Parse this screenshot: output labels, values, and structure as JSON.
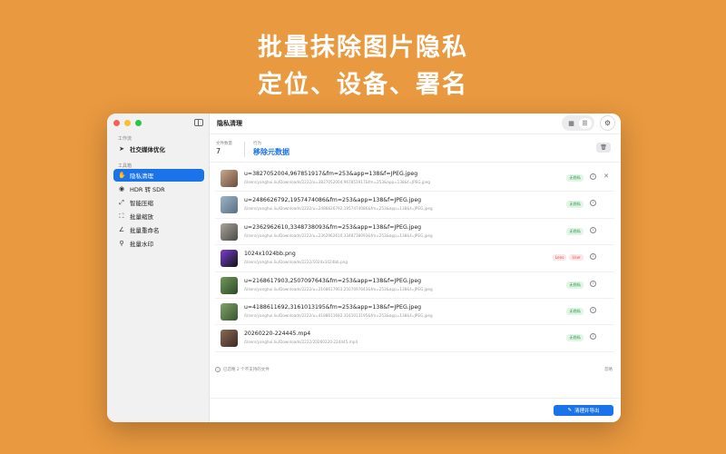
{
  "headline": {
    "line1": "批量抹除图片隐私",
    "line2": "定位、设备、署名"
  },
  "colors": {
    "background": "#E9993F",
    "accent": "#1a73e8",
    "badge_green": "#2f9c47",
    "badge_red": "#e05252"
  },
  "sidebar": {
    "workflow_title": "工作流",
    "workflow_items": [
      {
        "label": "社交媒体优化",
        "icon": "send-icon"
      }
    ],
    "tools_title": "工具箱",
    "tool_items": [
      {
        "label": "隐私清理",
        "icon": "privacy-icon",
        "active": true
      },
      {
        "label": "HDR 转 SDR",
        "icon": "hdr-icon"
      },
      {
        "label": "智能压缩",
        "icon": "compress-icon"
      },
      {
        "label": "批量缩放",
        "icon": "resize-icon"
      },
      {
        "label": "批量重命名",
        "icon": "rename-icon"
      },
      {
        "label": "批量水印",
        "icon": "watermark-icon"
      }
    ]
  },
  "header": {
    "title": "隐私清理"
  },
  "stats": {
    "count_label": "文件数量",
    "count_value": "7",
    "action_label": "行为",
    "action_value": "移除元数据"
  },
  "files": [
    {
      "name": "u=3827052004,967851917&fm=253&app=138&f=JPEG.jpeg",
      "path": "/Users/yanghui.liu/Downloads/2222/u=3827052004,967851917&fm=253&app=138&f=JPEG.jpeg",
      "badges": [
        "无隐私"
      ],
      "thumb": [
        "#c9a88f",
        "#6b4a3b"
      ],
      "close": true
    },
    {
      "name": "u=2486626792,1957474086&fm=253&app=138&f=JPEG.jpeg",
      "path": "/Users/yanghui.liu/Downloads/2222/u=2486626792,1957474086&fm=253&app=138&f=JPEG.jpeg",
      "badges": [
        "无隐私"
      ],
      "thumb": [
        "#9db4c9",
        "#5a6f80"
      ]
    },
    {
      "name": "u=2362962610,3348738093&fm=253&app=138&f=JPEG.jpeg",
      "path": "/Users/yanghui.liu/Downloads/2222/u=2362962610,3348738093&fm=253&app=138&f=JPEG.jpeg",
      "badges": [
        "无隐私"
      ],
      "thumb": [
        "#a9a49c",
        "#4c4a46"
      ]
    },
    {
      "name": "1024x1024bb.png",
      "path": "/Users/yanghui.liu/Downloads/2222/1024x1024bb.png",
      "badges": [
        "Lens",
        "User"
      ],
      "thumb": [
        "#7b3fd6",
        "#111111"
      ]
    },
    {
      "name": "u=2168617903,2507097643&fm=253&app=138&f=JPEG.jpeg",
      "path": "/Users/yanghui.liu/Downloads/2222/u=2168617903,2507097643&fm=253&app=138&f=JPEG.jpeg",
      "badges": [
        "无隐私"
      ],
      "thumb": [
        "#6f9a5a",
        "#2e4a2a"
      ]
    },
    {
      "name": "u=4188611692,3161013195&fm=253&app=138&f=JPEG.jpeg",
      "path": "/Users/yanghui.liu/Downloads/2222/u=4188611692,3161013195&fm=253&app=138&f=JPEG.jpeg",
      "badges": [
        "无隐私"
      ],
      "thumb": [
        "#7fa26a",
        "#3a5530"
      ]
    },
    {
      "name": "20260220-224445.mp4",
      "path": "/Users/yanghui.liu/Downloads/2222/20260220-224445.mp4",
      "badges": [
        "无隐私"
      ],
      "thumb": [
        "#8a6a55",
        "#3b2a22"
      ]
    }
  ],
  "footer": {
    "note": "已忽略 2 个不支持的文件",
    "right_link": "忽略",
    "export_button": "清理并导出"
  }
}
